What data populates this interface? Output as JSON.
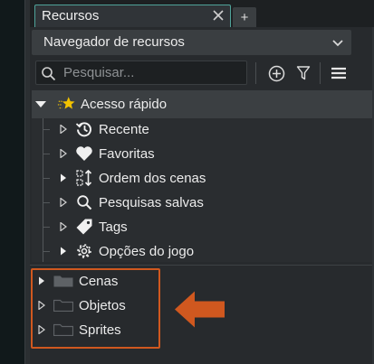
{
  "tab": {
    "label": "Recursos",
    "add_label": "+"
  },
  "dropdown": {
    "label": "Navegador de recursos"
  },
  "search": {
    "placeholder": "Pesquisar..."
  },
  "quick_access": {
    "label": "Acesso rápido",
    "items": [
      {
        "label": "Recente",
        "icon": "history-icon"
      },
      {
        "label": "Favoritas",
        "icon": "heart-icon"
      },
      {
        "label": "Ordem dos cenas",
        "icon": "room-order-icon"
      },
      {
        "label": "Pesquisas salvas",
        "icon": "search-icon"
      },
      {
        "label": "Tags",
        "icon": "tag-icon"
      },
      {
        "label": "Opções do jogo",
        "icon": "gear-icon"
      }
    ]
  },
  "folders": [
    {
      "label": "Cenas",
      "icon": "folder-icon"
    },
    {
      "label": "Objetos",
      "icon": "folder-icon"
    },
    {
      "label": "Sprites",
      "icon": "folder-icon"
    }
  ],
  "colors": {
    "accent": "#4fa39a",
    "highlight": "#d0581f",
    "star": "#f2c200"
  }
}
